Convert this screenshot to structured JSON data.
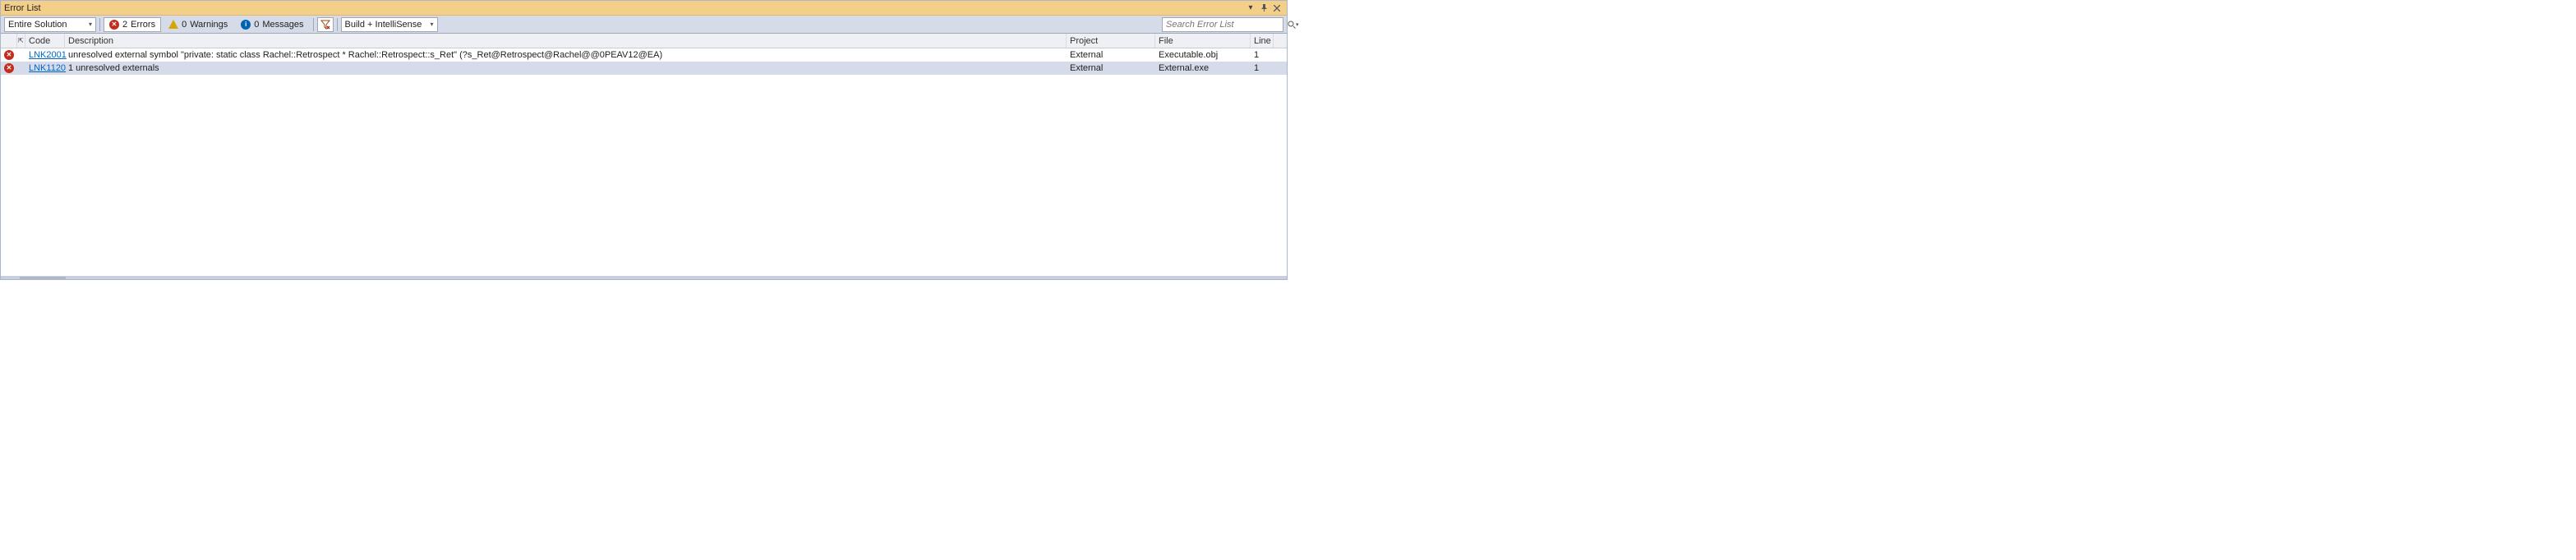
{
  "titlebar": {
    "title": "Error List"
  },
  "toolbar": {
    "scope_selected": "Entire Solution",
    "errors": {
      "count": "2",
      "label": "Errors"
    },
    "warnings": {
      "count": "0",
      "label": "Warnings"
    },
    "messages": {
      "count": "0",
      "label": "Messages"
    },
    "source_selected": "Build + IntelliSense",
    "search_placeholder": "Search Error List"
  },
  "columns": {
    "code": "Code",
    "description": "Description",
    "project": "Project",
    "file": "File",
    "line": "Line"
  },
  "rows": [
    {
      "severity": "error",
      "code": "LNK2001",
      "description": "unresolved external symbol \"private: static class Rachel::Retrospect * Rachel::Retrospect::s_Ret\" (?s_Ret@Retrospect@Rachel@@0PEAV12@EA)",
      "project": "External",
      "file": "Executable.obj",
      "line": "1",
      "selected": false
    },
    {
      "severity": "error",
      "code": "LNK1120",
      "description": "1 unresolved externals",
      "project": "External",
      "file": "External.exe",
      "line": "1",
      "selected": true
    }
  ]
}
